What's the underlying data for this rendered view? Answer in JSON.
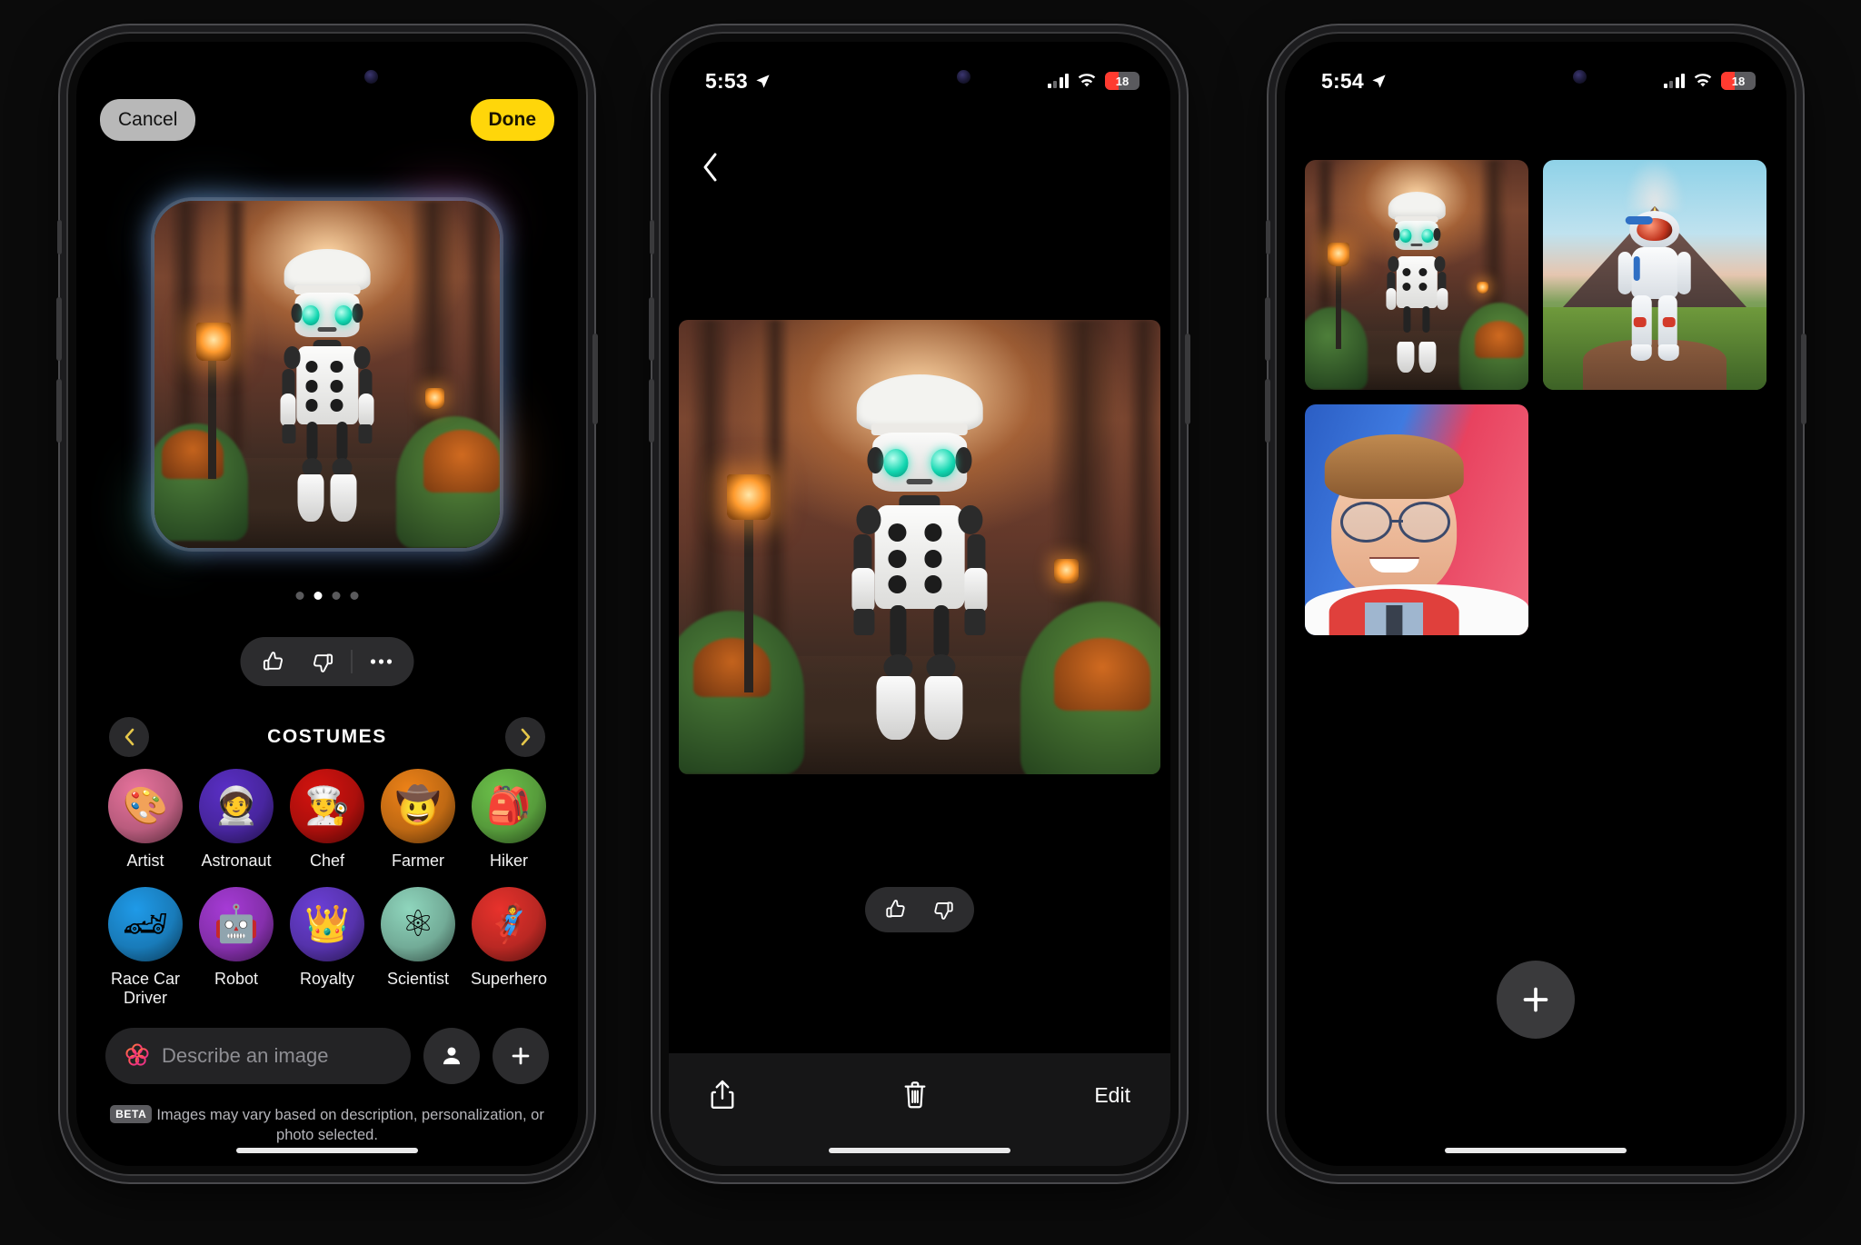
{
  "phone1": {
    "header": {
      "cancel_label": "Cancel",
      "done_label": "Done"
    },
    "preview": {
      "alt": "chef-robot-in-forest",
      "page_count": 4,
      "active_page": 2
    },
    "feedback": {
      "thumbs_up": "thumbs-up-icon",
      "thumbs_down": "thumbs-down-icon",
      "more": "more-options-icon"
    },
    "category": {
      "title": "COSTUMES",
      "prev": "chevron-left-icon",
      "next": "chevron-right-icon"
    },
    "costumes": [
      {
        "label": "Artist",
        "glyph": "🎨",
        "color": "#e8739d"
      },
      {
        "label": "Astronaut",
        "glyph": "🧑‍🚀",
        "color": "#5a2fc6"
      },
      {
        "label": "Chef",
        "glyph": "👨‍🍳",
        "color": "#d6130f"
      },
      {
        "label": "Farmer",
        "glyph": "🤠",
        "color": "#ef8318"
      },
      {
        "label": "Hiker",
        "glyph": "🎒",
        "color": "#6cc24a"
      },
      {
        "label": "Race Car Driver",
        "glyph": "🏎",
        "color": "#1f9ae8"
      },
      {
        "label": "Robot",
        "glyph": "🤖",
        "color": "#a63bd6"
      },
      {
        "label": "Royalty",
        "glyph": "👑",
        "color": "#6b3fd6"
      },
      {
        "label": "Scientist",
        "glyph": "⚛",
        "color": "#8fd6bd"
      },
      {
        "label": "Superhero",
        "glyph": "🦸",
        "color": "#e8322c"
      }
    ],
    "compose": {
      "placeholder": "Describe an image",
      "sparkle_icon": "image-playground-icon",
      "person_icon": "person-icon",
      "add_icon": "plus-icon"
    },
    "disclaimer": {
      "badge": "BETA",
      "text": "Images may vary based on description, personalization, or photo selected."
    }
  },
  "phone2": {
    "status": {
      "time": "5:53",
      "location_icon": "location-arrow-icon",
      "battery": "18"
    },
    "back_icon": "chevron-left-icon",
    "image": {
      "alt": "chef-robot-in-forest-fullscreen"
    },
    "feedback": {
      "thumbs_up": "thumbs-up-icon",
      "thumbs_down": "thumbs-down-icon"
    },
    "toolbar": {
      "share_icon": "share-icon",
      "delete_icon": "trash-icon",
      "edit_label": "Edit"
    }
  },
  "phone3": {
    "status": {
      "time": "5:54",
      "location_icon": "location-arrow-icon",
      "battery": "18"
    },
    "thumbnails": [
      {
        "alt": "chef-robot-in-forest",
        "scene": "forest"
      },
      {
        "alt": "astronaut-at-volcano",
        "scene": "volcano"
      },
      {
        "alt": "man-with-glasses-red-scarf",
        "scene": "portrait"
      }
    ],
    "fab": {
      "icon": "plus-icon"
    }
  },
  "colors": {
    "accent_yellow": "#ffd60a",
    "battery_red": "#ff3b30",
    "surface": "#2c2c2e",
    "background": "#000000"
  }
}
